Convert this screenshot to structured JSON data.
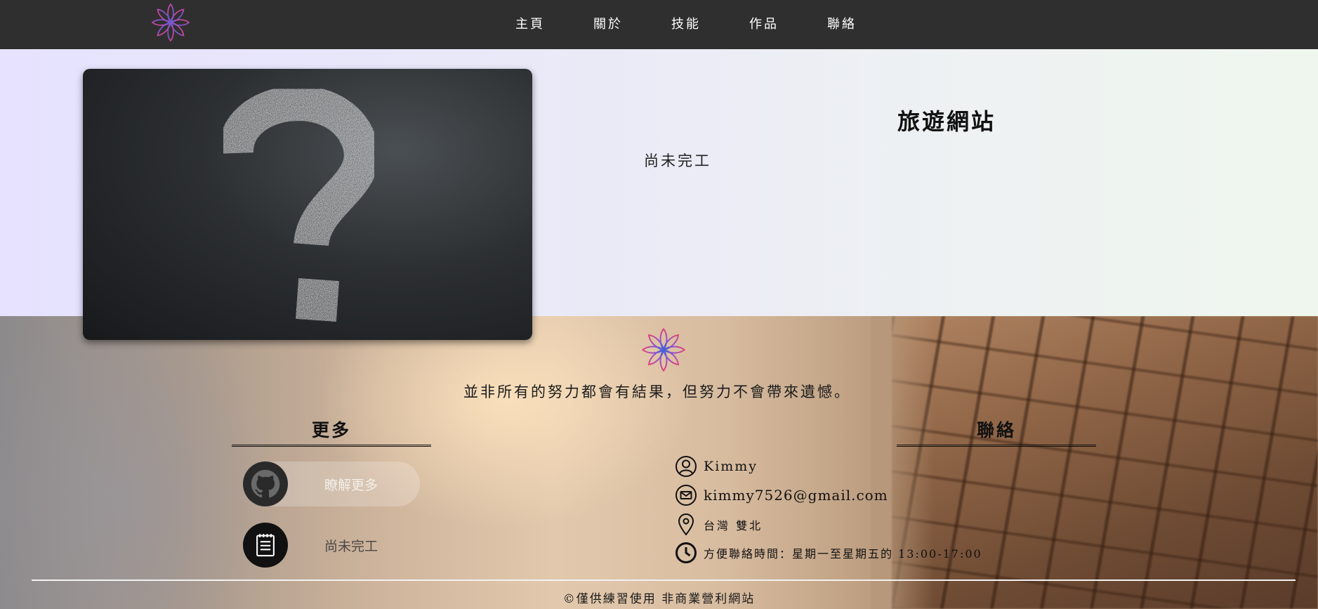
{
  "nav": {
    "logo_icon": "lotus-logo-icon",
    "items": [
      {
        "label": "主頁"
      },
      {
        "label": "關於"
      },
      {
        "label": "技能"
      },
      {
        "label": "作品"
      },
      {
        "label": "聯絡"
      }
    ]
  },
  "project": {
    "image": "chalkboard-question-mark",
    "title": "旅遊網站",
    "description": "尚未完工"
  },
  "footer": {
    "logo_icon": "lotus-logo-icon",
    "quote": "並非所有的努力都會有結果，但努力不會帶來遺憾。",
    "more": {
      "heading": "更多",
      "links": [
        {
          "icon": "github-icon",
          "label": "瞭解更多"
        },
        {
          "icon": "notepad-icon",
          "label": "尚未完工"
        }
      ]
    },
    "contact": {
      "heading": "聯絡",
      "name": "Kimmy",
      "email": "kimmy7526@gmail.com",
      "location": "台灣 雙北",
      "hours": "方便聯絡時間：星期一至星期五的 13:00-17:00"
    },
    "copyright": "©僅供練習使用 非商業營利網站"
  },
  "colors": {
    "navbar_bg": "#282828",
    "logo_gradient": [
      "#e0457b",
      "#9b4fc9",
      "#3f63d6"
    ]
  }
}
